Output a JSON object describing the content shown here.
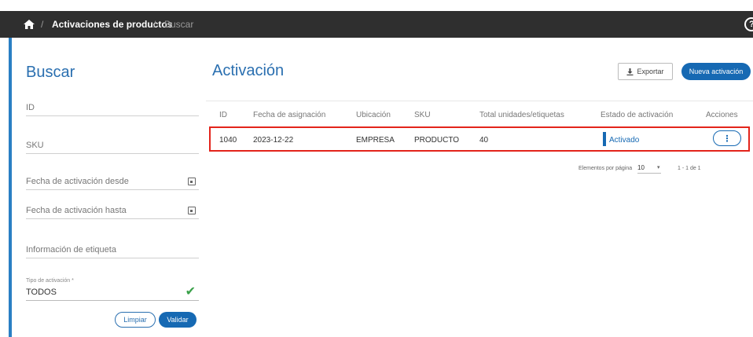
{
  "breadcrumb": {
    "home_icon": "home-icon",
    "sep": "/",
    "item1": "Activaciones de productos",
    "item2": "Buscar",
    "help_icon": "help-circle-icon",
    "help_glyph": "?"
  },
  "left": {
    "title": "Buscar",
    "fields": {
      "id": "ID",
      "sku": "SKU",
      "fecha_desde": "Fecha de activación desde",
      "fecha_hasta": "Fecha de activación hasta",
      "info_etiqueta": "Información de etiqueta"
    },
    "tipo_label": "Tipo de activación *",
    "tipo_value": "TODOS",
    "check_icon": "check-icon",
    "limpiar": "Limpiar",
    "validar": "Validar"
  },
  "main": {
    "title": "Activación",
    "export_label": "Exportar",
    "export_icon": "download-icon",
    "nueva_label": "Nueva activación",
    "table": {
      "headers": [
        "ID",
        "Fecha de asignación",
        "Ubicación",
        "SKU",
        "Total unidades/etiquetas",
        "Estado de activación",
        "Acciones"
      ],
      "rows": [
        {
          "id": "1040",
          "fecha": "2023-12-22",
          "ubicacion": "EMPRESA",
          "sku": "PRODUCTO",
          "total": "40",
          "estado": "Activado",
          "acciones_icon": "more-vertical-icon",
          "acciones_glyph": "⋮"
        }
      ]
    },
    "pagination": {
      "label": "Elementos por página",
      "per_page": "10",
      "dropdown_glyph": "▾",
      "range": "1 - 1 de 1"
    }
  },
  "colors": {
    "accent": "#1669b3",
    "title_blue": "#2a6fb0",
    "highlight_red": "#e3241b",
    "check_green": "#3aa14a",
    "topbar": "#2f2f2f"
  }
}
